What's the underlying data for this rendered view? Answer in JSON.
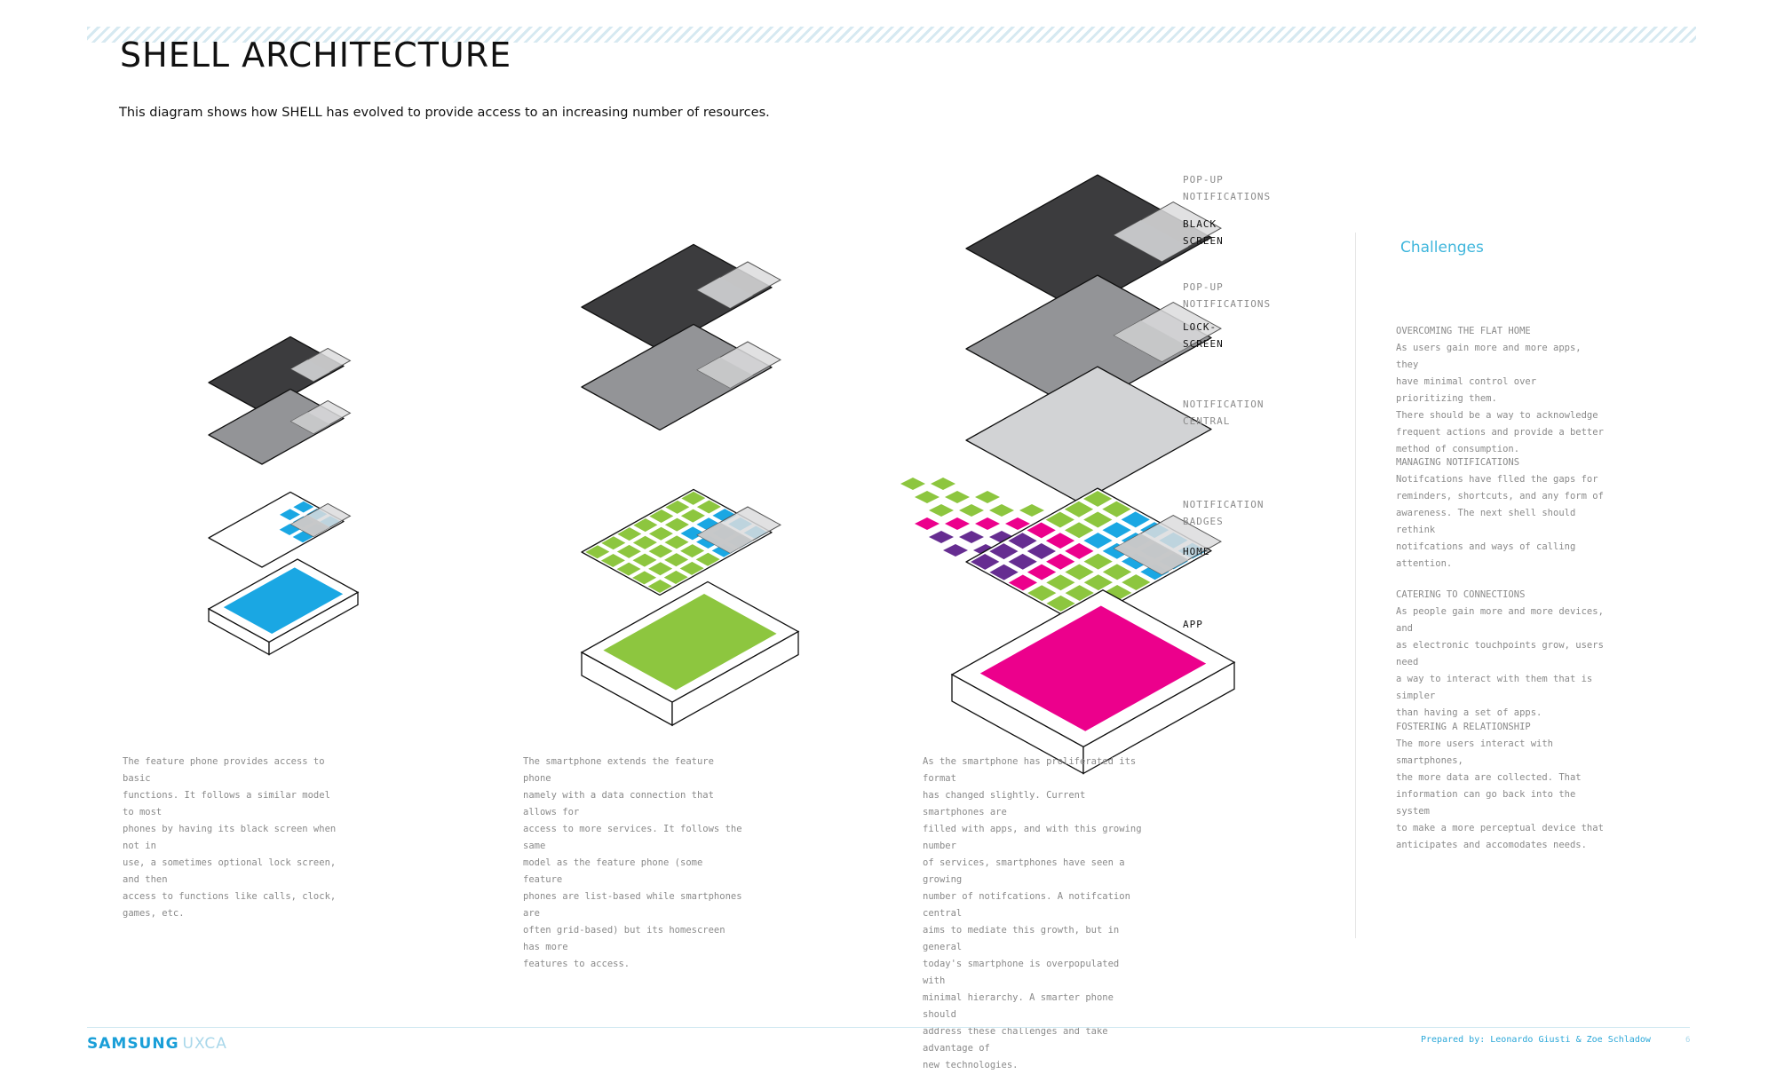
{
  "page": {
    "title": "SHELL ARCHITECTURE",
    "subtitle": "This diagram shows how SHELL has evolved to provide access to an increasing number of resources."
  },
  "colors": {
    "black_screen": "#3c3c3e",
    "lock_screen": "#939497",
    "notification_central": "#d2d3d5",
    "popup": "#dcdcdd",
    "feature_app": "#1aa7e3",
    "smartphone_app": "#8dc63f",
    "current_app": "#ec008c",
    "badge_purple": "#662d91",
    "accent": "#3fb6dc"
  },
  "layer_labels": [
    {
      "text": "POP-UP\nNOTIFICATIONS",
      "style": "light"
    },
    {
      "text": "BLACK\nSCREEN",
      "style": "dark"
    },
    {
      "text": "POP-UP\nNOTIFICATIONS",
      "style": "light"
    },
    {
      "text": "LOCK-\nSCREEN",
      "style": "dark"
    },
    {
      "text": "NOTIFICATION\nCENTRAL",
      "style": "light"
    },
    {
      "text": "NOTIFICATION\nBADGES",
      "style": "light"
    },
    {
      "text": "HOME",
      "style": "dark"
    },
    {
      "text": "APP",
      "style": "dark"
    }
  ],
  "captions": [
    "The feature phone provides access to basic\nfunctions.  It follows a similar model to most\nphones by having its black screen when not in\nuse, a sometimes optional lock screen, and then\naccess to functions like calls, clock, games, etc.",
    "The smartphone extends the feature phone\nnamely with a data connection that allows for\naccess to more services.  It follows the same\nmodel as the feature phone (some feature\nphones are list-based while smartphones are\noften grid-based) but its homescreen has more\nfeatures to access.",
    "As the smartphone has proliferated its format\nhas changed slightly.  Current smartphones are\nfilled with apps, and with this growing number\nof services, smartphones have seen a growing\nnumber of notifcations.  A notifcation central\naims to mediate this growth, but in general\ntoday's smartphone is overpopulated with\nminimal hierarchy.  A smarter phone should\naddress these challenges and take advantage of\nnew technologies."
  ],
  "challenges": {
    "title": "Challenges",
    "items": [
      {
        "heading": "OVERCOMING THE FLAT HOME",
        "body": "As users gain more and more apps, they\nhave minimal control over prioritizing them.\nThere should be a way to acknowledge\nfrequent actions and provide a better\nmethod of consumption."
      },
      {
        "heading": "MANAGING NOTIFICATIONS",
        "body": "Notifcations have flled the gaps for\nreminders, shortcuts, and any form of\nawareness.  The next shell should rethink\nnotifcations and ways of calling attention."
      },
      {
        "heading": "CATERING TO CONNECTIONS",
        "body": "As people gain more and more devices, and\nas electronic touchpoints grow, users need\na way to interact with them that is simpler\nthan having a set of apps."
      },
      {
        "heading": "FOSTERING A RELATIONSHIP",
        "body": "The more users interact with smartphones,\nthe more data are collected.  That\ninformation can go back into the system\nto make a more perceptual device that\nanticipates and accomodates needs."
      }
    ]
  },
  "footer": {
    "brand": "SAMSUNG",
    "brand_suffix": "UXCA",
    "prepared_by": "Prepared by: Leonardo Giusti & Zoe Schladow",
    "page_number": "6"
  }
}
